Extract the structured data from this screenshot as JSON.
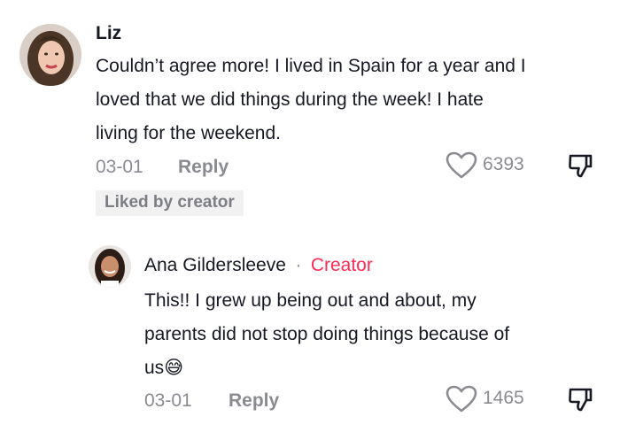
{
  "comment": {
    "author": "Liz",
    "text": "Couldn’t agree more! I lived in Spain for a year and I loved that we did things during the week! I hate living for the weekend.",
    "lines": [
      "Couldn’t agree more! I lived in Spain for a year and I",
      "loved that we did things during the week! I hate",
      "living for the weekend."
    ],
    "date": "03-01",
    "reply_label": "Reply",
    "like_count": "6393",
    "liked_by_creator": "Liked by creator"
  },
  "reply": {
    "author": "Ana Gildersleeve",
    "separator": "·",
    "creator_label": "Creator",
    "lines": [
      "This!! I grew up being out and about, my",
      "parents did not stop doing things because of",
      "us"
    ],
    "emoji": "😅",
    "date": "03-01",
    "reply_label": "Reply",
    "like_count": "1465"
  },
  "colors": {
    "creator": "#fe2c55",
    "muted": "#8a8b91",
    "text": "#161823"
  }
}
